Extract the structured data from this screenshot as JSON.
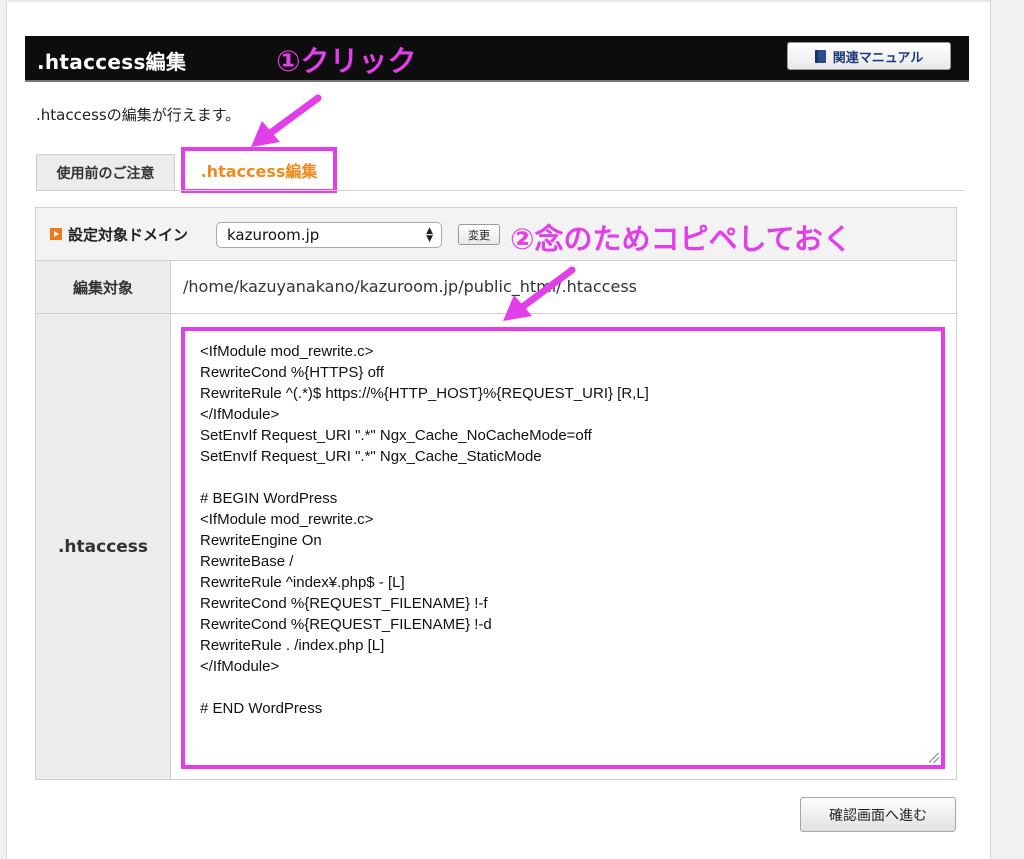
{
  "header": {
    "title": ".htaccess編集",
    "manual_button": "関連マニュアル"
  },
  "annotations": {
    "step1": "①クリック",
    "step2": "②念のためコピペしておく",
    "color": "#e23ee9"
  },
  "description": ".htaccessの編集が行えます。",
  "tabs": [
    {
      "label": "使用前のご注意",
      "active": false
    },
    {
      "label": ".htaccess編集",
      "active": true
    }
  ],
  "domain": {
    "label": "設定対象ドメイン",
    "selected": "kazuroom.jp",
    "change_button": "変更"
  },
  "target": {
    "label": "編集対象",
    "path": "/home/kazuyanakano/kazuroom.jp/public_html/.htaccess"
  },
  "htaccess": {
    "label": ".htaccess",
    "content": "<IfModule mod_rewrite.c>\nRewriteCond %{HTTPS} off\nRewriteRule ^(.*)$ https://%{HTTP_HOST}%{REQUEST_URI} [R,L]\n</IfModule>\nSetEnvIf Request_URI \".*\" Ngx_Cache_NoCacheMode=off\nSetEnvIf Request_URI \".*\" Ngx_Cache_StaticMode\n\n# BEGIN WordPress\n<IfModule mod_rewrite.c>\nRewriteEngine On\nRewriteBase /\nRewriteRule ^index¥.php$ - [L]\nRewriteCond %{REQUEST_FILENAME} !-f\nRewriteCond %{REQUEST_FILENAME} !-d\nRewriteRule . /index.php [L]\n</IfModule>\n\n# END WordPress"
  },
  "confirm_button": "確認画面へ進む",
  "colors": {
    "accent_orange": "#f08a1c",
    "header_bg": "#0d0d0d"
  }
}
